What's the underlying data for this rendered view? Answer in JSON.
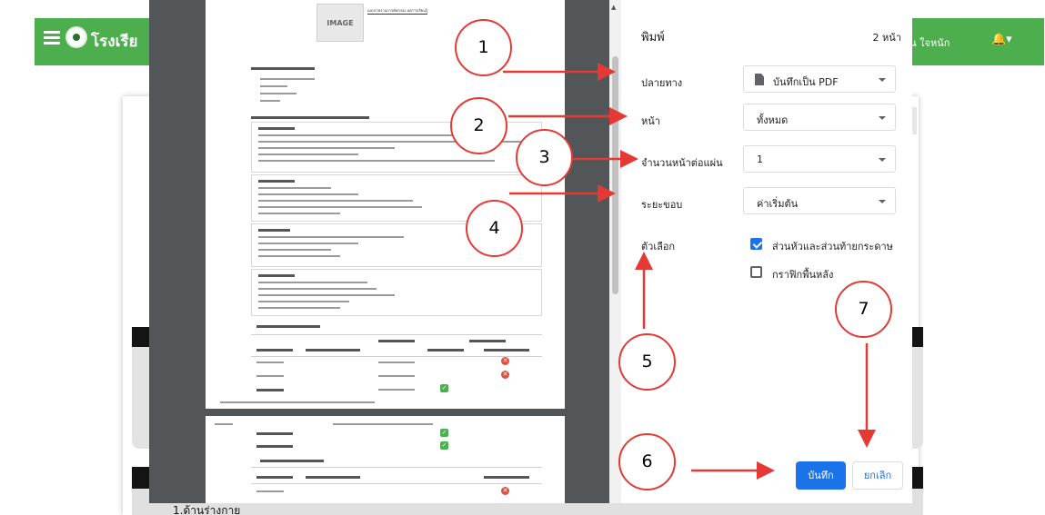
{
  "app": {
    "school_name": "โรงเรีย",
    "user_name": "เรียน ใจหนัก",
    "bell_icon": "bell-icon",
    "section_label": "1.ด้านร่างกาย"
  },
  "preview": {
    "image_placeholder": "IMAGE",
    "doc_header": "แบบรายงานการคัดกรอง ผลการเรียนรู้"
  },
  "print": {
    "title": "พิมพ์",
    "page_count": "2 หน้า",
    "destination": {
      "label": "ปลายทาง",
      "value": "บันทึกเป็น PDF",
      "icon": "pdf-file-icon"
    },
    "pages": {
      "label": "หน้า",
      "value": "ทั้งหมด"
    },
    "pages_per_sheet": {
      "label": "จำนวนหน้าต่อแผ่น",
      "value": "1"
    },
    "margins": {
      "label": "ระยะขอบ",
      "value": "ค่าเริ่มต้น"
    },
    "options": {
      "label": "ตัวเลือก",
      "headers_footers": {
        "label": "ส่วนหัวและส่วนท้ายกระดาษ",
        "checked": true
      },
      "background_graphics": {
        "label": "กราฟิกพื้นหลัง",
        "checked": false
      }
    },
    "save_button": "บันทึก",
    "cancel_button": "ยกเลิก"
  },
  "annotations": {
    "callouts": [
      "1",
      "2",
      "3",
      "4",
      "5",
      "6",
      "7"
    ],
    "arrow_color": "#e53935"
  },
  "colors": {
    "app_bar": "#4cae4c",
    "primary_button": "#1a73e8",
    "preview_bg": "#525659"
  }
}
